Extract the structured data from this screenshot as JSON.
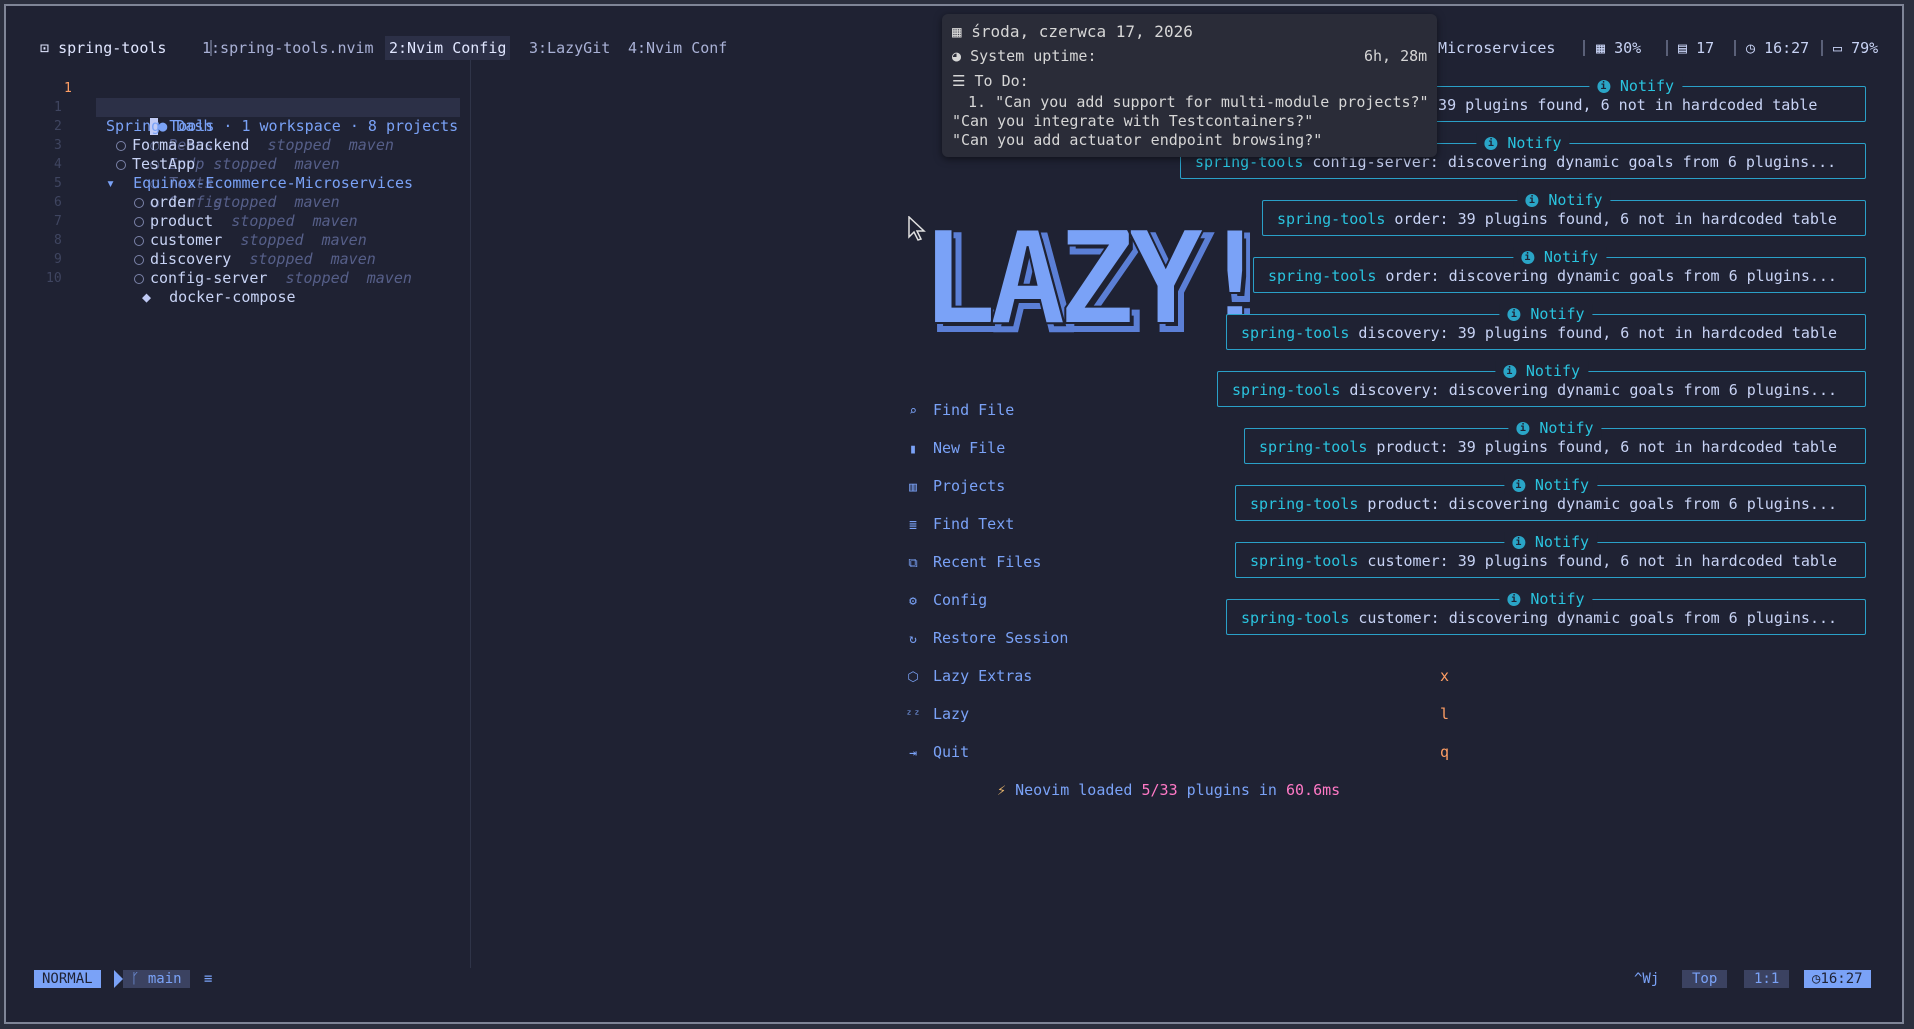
{
  "tabline": {
    "session_name": "spring-tools",
    "tabs": [
      {
        "label": "1:spring-tools.nvim"
      },
      {
        "label": "2:Nvim Config"
      },
      {
        "label": "3:LazyGit"
      },
      {
        "label": "4:Nvim Conf"
      }
    ],
    "status": {
      "project_fragment": "e-Microservices",
      "cpu": "30%",
      "date_day": "17",
      "time": "16:27",
      "battery": "79%"
    }
  },
  "popup": {
    "date": "środa, czerwca 17, 2026",
    "uptime_label": "System uptime:",
    "uptime_value": "6h, 28m",
    "todo_label": "To Do:",
    "todos": [
      "1. \"Can you add support for multi-module projects?\"",
      "\"Can you integrate with Testcontainers?\"",
      "\"Can you add actuator endpoint browsing?\""
    ]
  },
  "tree": {
    "tabs": [
      "Dash",
      "Beans",
      "Endp",
      "Tests",
      "Config"
    ],
    "header": "Spring Tools · 1 workspace · 8 projects",
    "line_numbers": [
      "1",
      "1",
      "2",
      "3",
      "4",
      "5",
      "6",
      "7",
      "8",
      "9",
      "10"
    ],
    "projects": [
      {
        "name": "Forma-Backend",
        "state": "stopped",
        "build": "maven"
      },
      {
        "name": "TestApp",
        "state": "stopped",
        "build": "maven"
      }
    ],
    "workspace": {
      "name": "Equinox-Ecommerce-Microservices",
      "children": [
        {
          "name": "order",
          "state": "stopped",
          "build": "maven"
        },
        {
          "name": "product",
          "state": "stopped",
          "build": "maven"
        },
        {
          "name": "customer",
          "state": "stopped",
          "build": "maven"
        },
        {
          "name": "discovery",
          "state": "stopped",
          "build": "maven"
        },
        {
          "name": "config-server",
          "state": "stopped",
          "build": "maven"
        }
      ],
      "extra": "docker-compose"
    }
  },
  "dashboard": {
    "logo_text": "LAZY!",
    "menu": [
      {
        "label": "Find File",
        "icon": "search-icon",
        "key": ""
      },
      {
        "label": "New File",
        "icon": "file-icon",
        "key": ""
      },
      {
        "label": "Projects",
        "icon": "projects-icon",
        "key": ""
      },
      {
        "label": "Find Text",
        "icon": "text-icon",
        "key": ""
      },
      {
        "label": "Recent Files",
        "icon": "recent-icon",
        "key": ""
      },
      {
        "label": "Config",
        "icon": "gear-icon",
        "key": ""
      },
      {
        "label": "Restore Session",
        "icon": "restore-icon",
        "key": ""
      },
      {
        "label": "Lazy Extras",
        "icon": "cube-icon",
        "key": "x"
      },
      {
        "label": "Lazy",
        "icon": "sleep-icon",
        "key": "l"
      },
      {
        "label": "Quit",
        "icon": "quit-icon",
        "key": "q"
      }
    ],
    "footer": {
      "prefix": "Neovim loaded",
      "count": "5/33",
      "middle": "plugins in",
      "time": "60.6ms"
    }
  },
  "notifications": [
    {
      "title": "Notify",
      "source": "",
      "message": ": 39 plugins found, 6 not in hardcoded table"
    },
    {
      "title": "Notify",
      "source": "spring-tools",
      "message": " config-server: discovering dynamic goals from 6 plugins..."
    },
    {
      "title": "Notify",
      "source": "spring-tools",
      "message": " order: 39 plugins found, 6 not in hardcoded table"
    },
    {
      "title": "Notify",
      "source": "spring-tools",
      "message": " order: discovering dynamic goals from 6 plugins..."
    },
    {
      "title": "Notify",
      "source": "spring-tools",
      "message": " discovery: 39 plugins found, 6 not in hardcoded table"
    },
    {
      "title": "Notify",
      "source": "spring-tools",
      "message": " discovery: discovering dynamic goals from 6 plugins..."
    },
    {
      "title": "Notify",
      "source": "spring-tools",
      "message": " product: 39 plugins found, 6 not in hardcoded table"
    },
    {
      "title": "Notify",
      "source": "spring-tools",
      "message": " product: discovering dynamic goals from 6 plugins..."
    },
    {
      "title": "Notify",
      "source": "spring-tools",
      "message": " customer: 39 plugins found, 6 not in hardcoded table"
    },
    {
      "title": "Notify",
      "source": "spring-tools",
      "message": " customer: discovering dynamic goals from 6 plugins..."
    }
  ],
  "statusline": {
    "mode": "NORMAL",
    "branch": "main",
    "keys": "^Wj",
    "position": "Top",
    "cursor": "1:1",
    "time": "16:27"
  },
  "colors": {
    "background": "#1f2233",
    "accent_blue": "#7aa2f7",
    "notify_border": "#2aa0c8",
    "key_orange": "#ff9e64",
    "footer_pink": "#ff79c6"
  }
}
